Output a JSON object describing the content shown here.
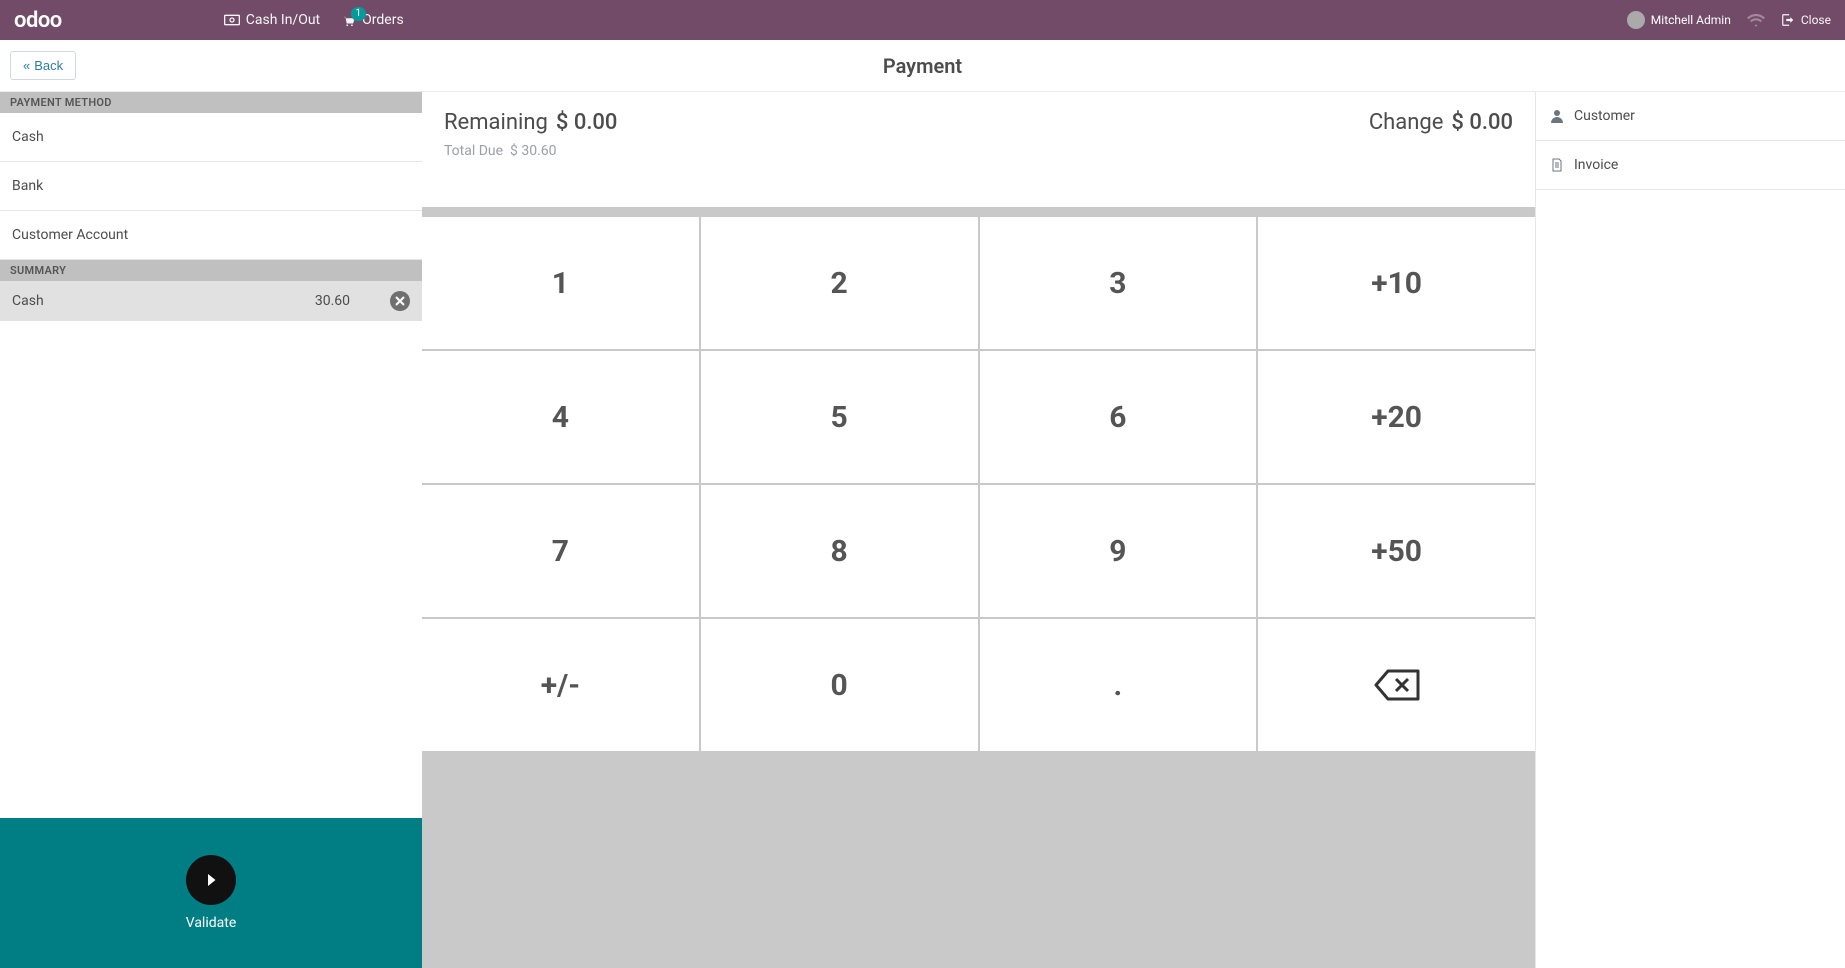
{
  "topbar": {
    "logo_text": "odoo",
    "cash_in_out": "Cash In/Out",
    "orders": "Orders",
    "orders_count": "1",
    "username": "Mitchell Admin",
    "close": "Close"
  },
  "header": {
    "back": "Back",
    "title": "Payment"
  },
  "payment_methods": {
    "header": "PAYMENT METHOD",
    "items": [
      {
        "label": "Cash"
      },
      {
        "label": "Bank"
      },
      {
        "label": "Customer Account"
      }
    ]
  },
  "summary": {
    "header": "SUMMARY",
    "lines": [
      {
        "name": "Cash",
        "amount": "30.60"
      }
    ]
  },
  "validate": {
    "label": "Validate"
  },
  "status": {
    "remaining_label": "Remaining",
    "remaining_value": "$ 0.00",
    "change_label": "Change",
    "change_value": "$ 0.00",
    "total_due_label": "Total Due",
    "total_due_value": "$ 30.60"
  },
  "numpad": {
    "k1": "1",
    "k2": "2",
    "k3": "3",
    "p10": "+10",
    "k4": "4",
    "k5": "5",
    "k6": "6",
    "p20": "+20",
    "k7": "7",
    "k8": "8",
    "k9": "9",
    "p50": "+50",
    "sign": "+/-",
    "k0": "0",
    "dot": "."
  },
  "right": {
    "customer": "Customer",
    "invoice": "Invoice"
  }
}
